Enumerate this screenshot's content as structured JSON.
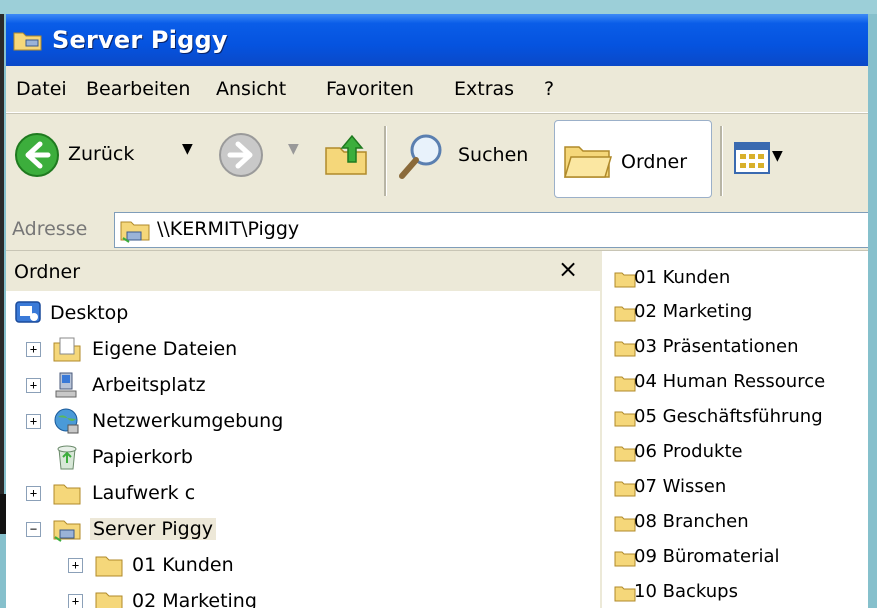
{
  "window": {
    "title": "Server Piggy"
  },
  "menu": [
    "Datei",
    "Bearbeiten",
    "Ansicht",
    "Favoriten",
    "Extras",
    "?"
  ],
  "toolbar": {
    "back_label": "Zurück",
    "search_label": "Suchen",
    "folders_label": "Ordner"
  },
  "address": {
    "label": "Adresse",
    "path": "\\\\KERMIT\\Piggy"
  },
  "folder_pane": {
    "title": "Ordner",
    "close_glyph": "×",
    "tree": [
      {
        "label": "Desktop",
        "expander": ""
      },
      {
        "label": "Eigene Dateien",
        "expander": "+"
      },
      {
        "label": "Arbeitsplatz",
        "expander": "+"
      },
      {
        "label": "Netzwerkumgebung",
        "expander": "+"
      },
      {
        "label": "Papierkorb",
        "expander": ""
      },
      {
        "label": "Laufwerk c",
        "expander": "+"
      },
      {
        "label": "Server Piggy",
        "expander": "−"
      },
      {
        "label": "01 Kunden",
        "expander": "+"
      },
      {
        "label": "02 Marketing",
        "expander": "+"
      }
    ]
  },
  "files": [
    "01 Kunden",
    "02 Marketing",
    "03 Präsentationen",
    "04 Human Ressource",
    "05 Geschäftsführung",
    "06 Produkte",
    "07 Wissen",
    "08 Branchen",
    "09 Büromaterial",
    "10 Backups"
  ],
  "colors": {
    "title_bar": "#0553df",
    "background": "#86c0cc",
    "folder": "#f5d77a"
  }
}
